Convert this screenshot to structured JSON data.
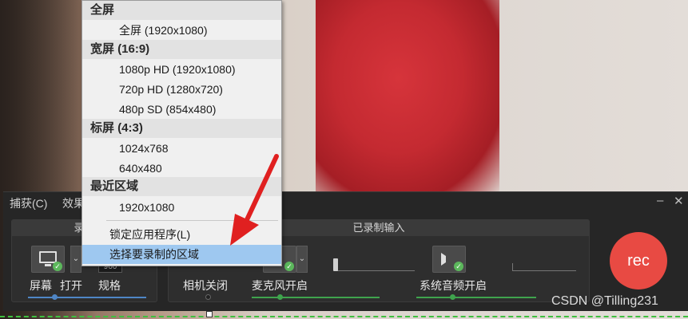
{
  "menu": {
    "sections": [
      {
        "label": "全屏",
        "items": [
          "全屏 (1920x1080)"
        ]
      },
      {
        "label": "宽屏 (16:9)",
        "items": [
          "1080p HD (1920x1080)",
          "720p HD (1280x720)",
          "480p SD (854x480)"
        ]
      },
      {
        "label": "标屏 (4:3)",
        "items": [
          "1024x768",
          "640x480"
        ]
      },
      {
        "label": "最近区域",
        "items": [
          "1920x1080"
        ]
      }
    ],
    "lock_app": "锁定应用程序(L)",
    "select_region": "选择要录制的区域"
  },
  "recorder": {
    "menubar": {
      "capture": "捕获(C)",
      "effects": "效果"
    },
    "window_controls": {
      "minimize": "–",
      "close": "✕"
    },
    "group1_head": "录制",
    "group2_head": "已录制输入",
    "screen_label": "屏幕",
    "open_label": "打开",
    "spec_label": "规格",
    "spec_value": "960",
    "camera_label": "相机关闭",
    "mic_label": "麦克风开启",
    "audio_label": "系统音频开启",
    "rec_label": "rec"
  },
  "watermark": "CSDN @Tilling231",
  "colors": {
    "rec": "#e84a43",
    "accent_green": "#3fa34d",
    "accent_blue": "#4f86c6",
    "selection": "#9ec8f0",
    "arrow": "#e02020"
  }
}
